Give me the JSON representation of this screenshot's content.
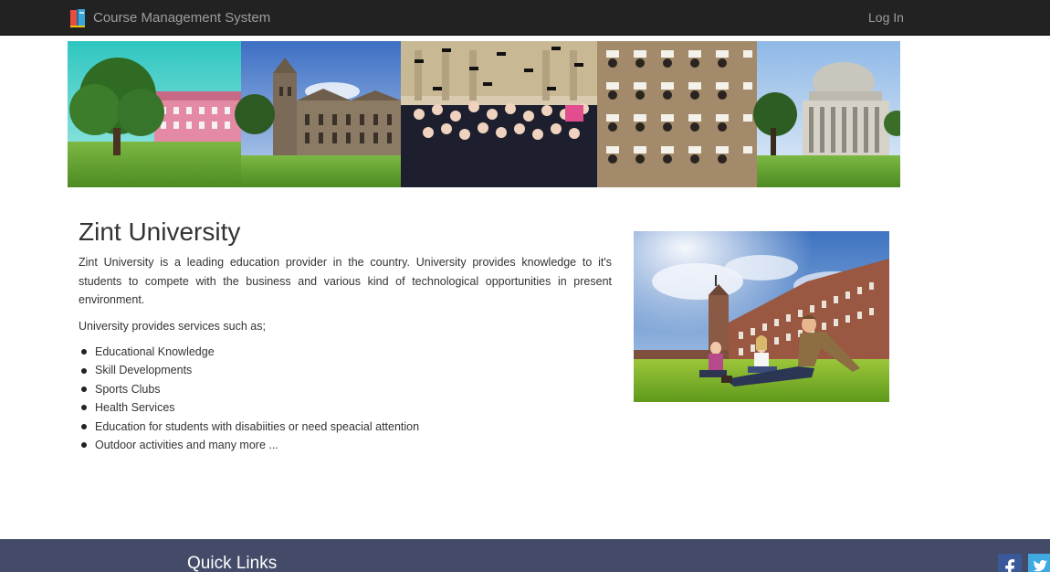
{
  "navbar": {
    "brand_text": "Course Management System",
    "login_label": "Log In",
    "background_color": "#222222"
  },
  "main": {
    "title": "Zint University",
    "description": "Zint University is a leading education provider in the country. University provides knowledge to it's students to compete with the business and various kind of technological opportunities in present environment.",
    "services_intro": "University provides services such as;",
    "services": [
      "Educational Knowledge",
      "Skill Developments",
      "Sports Clubs",
      "Health Services",
      "Education for students with disabiities or need speacial attention",
      "Outdoor activities and many more ..."
    ]
  },
  "footer": {
    "heading": "Quick Links",
    "background_color": "#434b69",
    "social_icons": [
      "facebook-icon",
      "twitter-icon"
    ]
  }
}
